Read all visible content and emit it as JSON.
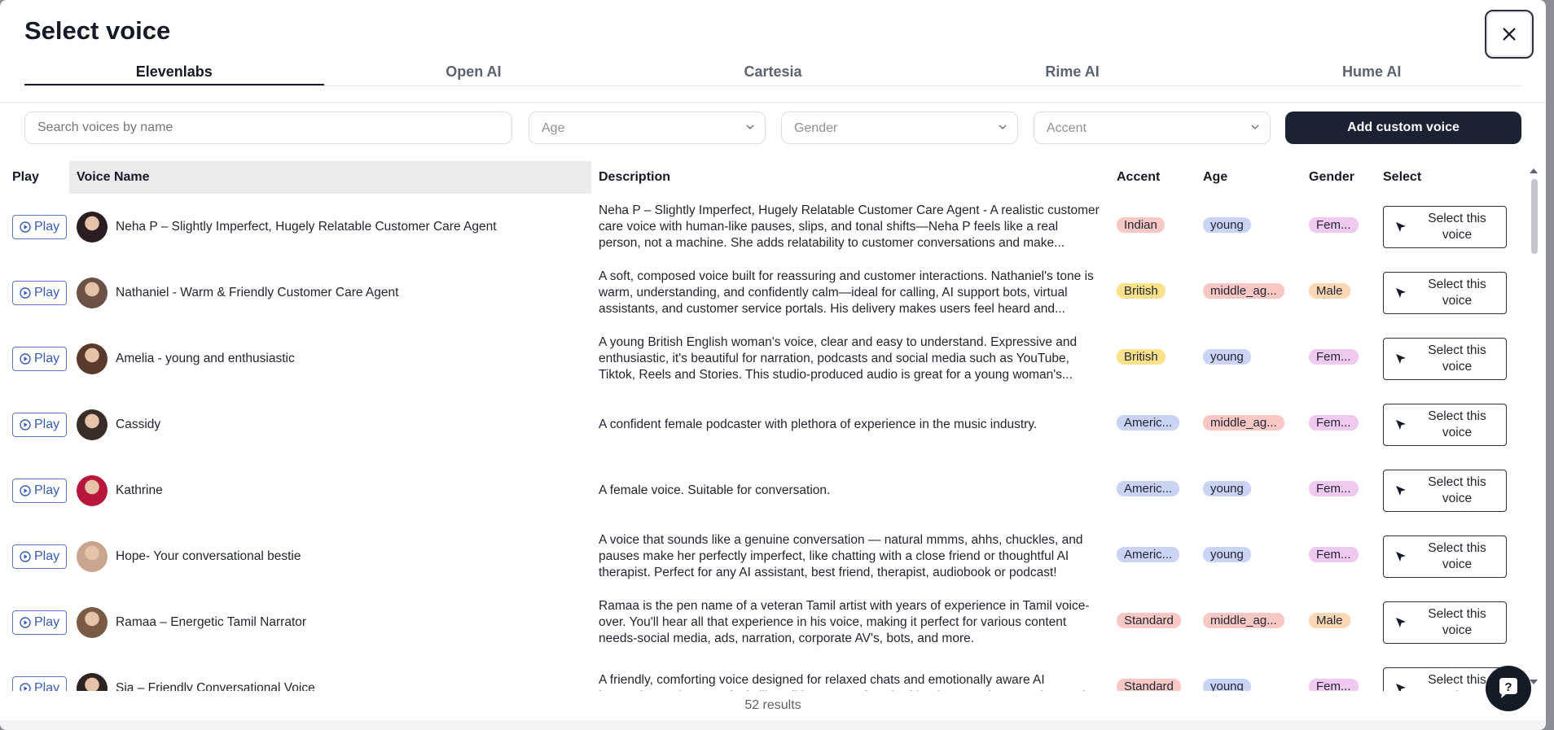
{
  "modal": {
    "title": "Select voice",
    "close_icon": "close-icon"
  },
  "tabs": [
    {
      "label": "Elevenlabs",
      "active": true
    },
    {
      "label": "Open AI",
      "active": false
    },
    {
      "label": "Cartesia",
      "active": false
    },
    {
      "label": "Rime AI",
      "active": false
    },
    {
      "label": "Hume AI",
      "active": false
    }
  ],
  "filters": {
    "search_placeholder": "Search voices by name",
    "age_placeholder": "Age",
    "gender_placeholder": "Gender",
    "accent_placeholder": "Accent",
    "add_button_label": "Add custom voice"
  },
  "table": {
    "headers": {
      "play": "Play",
      "name": "Voice Name",
      "description": "Description",
      "accent": "Accent",
      "age": "Age",
      "gender": "Gender",
      "select": "Select"
    },
    "play_label": "Play",
    "select_label": "Select this voice",
    "rows": [
      {
        "name": "Neha P – Slightly Imperfect, Hugely Relatable Customer Care Agent",
        "description": "Neha P – Slightly Imperfect, Hugely Relatable Customer Care Agent - A realistic customer care voice with human-like pauses, slips, and tonal shifts—Neha P feels like a real person, not a machine. She adds relatability to customer conversations and make...",
        "accent": "Indian",
        "age": "young",
        "gender": "Fem...",
        "avatar_color": "#2b1d22"
      },
      {
        "name": "Nathaniel - Warm & Friendly Customer Care Agent",
        "description": "A soft, composed voice built for reassuring and customer interactions. Nathaniel's tone is warm, understanding, and confidently calm—ideal for calling, AI support bots, virtual assistants, and customer service portals. His delivery makes users feel heard and...",
        "accent": "British",
        "age": "middle_ag...",
        "gender": "Male",
        "avatar_color": "#6b5244"
      },
      {
        "name": "Amelia - young and enthusiastic",
        "description": "A young British English woman's voice, clear and easy to understand. Expressive and enthusiastic, it's beautiful for narration, podcasts and social media such as YouTube, Tiktok, Reels and Stories. This studio-produced audio is great for a young woman's...",
        "accent": "British",
        "age": "young",
        "gender": "Fem...",
        "avatar_color": "#5a3a2c"
      },
      {
        "name": "Cassidy",
        "description": "A confident female podcaster with plethora of experience in the music industry.",
        "accent": "Americ...",
        "age": "middle_ag...",
        "gender": "Fem...",
        "avatar_color": "#3a2d28"
      },
      {
        "name": "Kathrine",
        "description": "A female voice. Suitable for conversation.",
        "accent": "Americ...",
        "age": "young",
        "gender": "Fem...",
        "avatar_color": "#b8173c"
      },
      {
        "name": "Hope- Your conversational bestie",
        "description": "A voice that sounds like a genuine conversation — natural mmms, ahhs, chuckles, and pauses make her perfectly imperfect, like chatting with a close friend or thoughtful AI therapist. Perfect for any AI assistant, best friend, therapist, audiobook or podcast!",
        "accent": "Americ...",
        "age": "young",
        "gender": "Fem...",
        "avatar_color": "#c9a58e"
      },
      {
        "name": "Ramaa – Energetic Tamil Narrator",
        "description": "Ramaa is the pen name of a veteran Tamil artist with years of experience in Tamil voice-over. You'll hear all that experience in his voice, making it perfect for various content needs-social media, ads, narration, corporate AV's, bots, and more.",
        "accent": "Standard",
        "age": "middle_ag...",
        "gender": "Male",
        "avatar_color": "#7a5a45"
      },
      {
        "name": "Sia – Friendly Conversational Voice",
        "description": "A friendly, comforting voice designed for relaxed chats and emotionally aware AI interactions. Sia's tone feels like talking to your favorite friend—natural, reassuring, and",
        "accent": "Standard",
        "age": "young",
        "gender": "Fem...",
        "avatar_color": "#2e2422"
      }
    ]
  },
  "badge_colors": {
    "Indian": "#f9c7c4",
    "British": "#fbe28a",
    "Americ...": "#c9d4f4",
    "Standard": "#f9c7c4",
    "young": "#c9d4f4",
    "middle_ag...": "#f9c7c4",
    "Fem...": "#efc9ef",
    "Male": "#fbd6b2"
  },
  "footer": {
    "results": "52 results",
    "help_icon": "help-icon"
  }
}
